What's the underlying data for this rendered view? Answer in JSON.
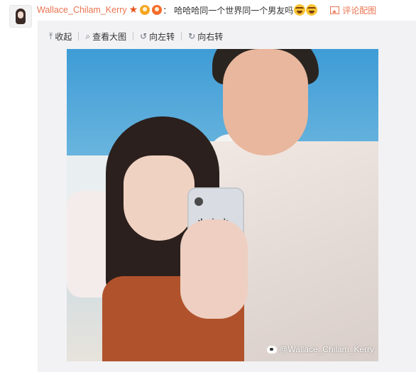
{
  "post": {
    "username": "Wallace_Chilam_Kerry",
    "colon": "：",
    "text": "哈哈哈同一个世界同一个男友吗",
    "comment_pic_label": "评论配图"
  },
  "toolbar": {
    "collapse": "收起",
    "view_large": "查看大图",
    "rotate_left": "向左转",
    "rotate_right": "向右转"
  },
  "image": {
    "watermark": "@Wallace_Chilam_Kerry"
  },
  "icons": {
    "star": "★",
    "collapse": "⤒",
    "search": "⌕",
    "rotate_left": "↺",
    "rotate_right": "↻"
  },
  "colors": {
    "accent": "#eb7350",
    "toolbar_bg": "#f2f2f5",
    "text": "#333333"
  }
}
